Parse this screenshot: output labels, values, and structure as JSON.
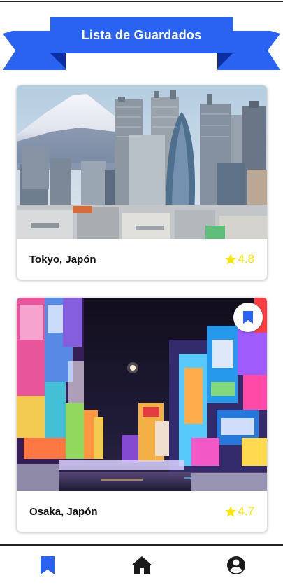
{
  "header": {
    "title": "Lista de Guardados",
    "ribbon_color": "#2a62f2",
    "ribbon_fold_color": "#0b2fa0"
  },
  "saved_places": [
    {
      "name": "Tokyo, Japón",
      "rating": "4.8",
      "image": "tokyo-skyline-mount-fuji"
    },
    {
      "name": "Osaka, Japón",
      "rating": "4.7",
      "image": "osaka-dotonbori-night",
      "bookmark_icon": "bookmark-icon"
    }
  ],
  "nav": {
    "items": [
      {
        "icon": "bookmark-icon",
        "active": true
      },
      {
        "icon": "home-icon",
        "active": false
      },
      {
        "icon": "account-icon",
        "active": false
      }
    ],
    "active_color": "#2a62f2",
    "inactive_color": "#1a1a1a"
  },
  "colors": {
    "star": "#f7e600"
  }
}
